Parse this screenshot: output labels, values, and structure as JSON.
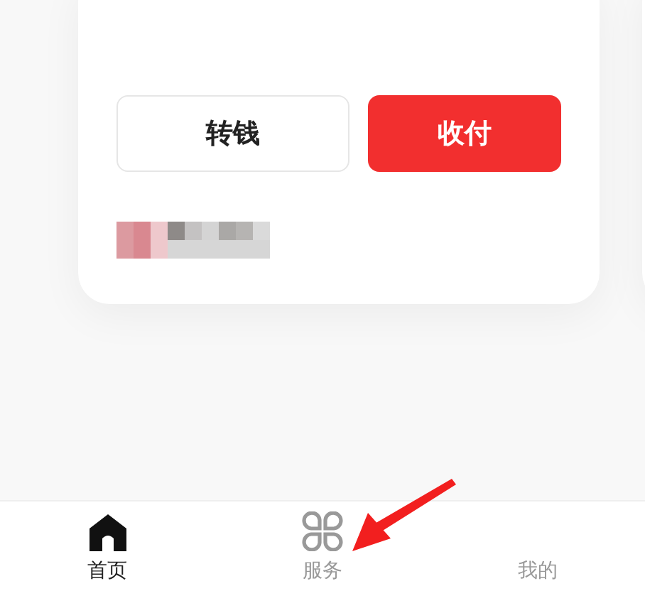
{
  "card": {
    "buttons": [
      {
        "label": "转钱",
        "kind": "outline"
      },
      {
        "label": "收付",
        "kind": "primary"
      }
    ]
  },
  "tab_bar": [
    {
      "label": "首页",
      "selected": true,
      "kind": "home"
    },
    {
      "label": "服务",
      "selected": false,
      "kind": "grid"
    },
    {
      "label": "我的",
      "selected": false,
      "kind": "plain"
    }
  ]
}
